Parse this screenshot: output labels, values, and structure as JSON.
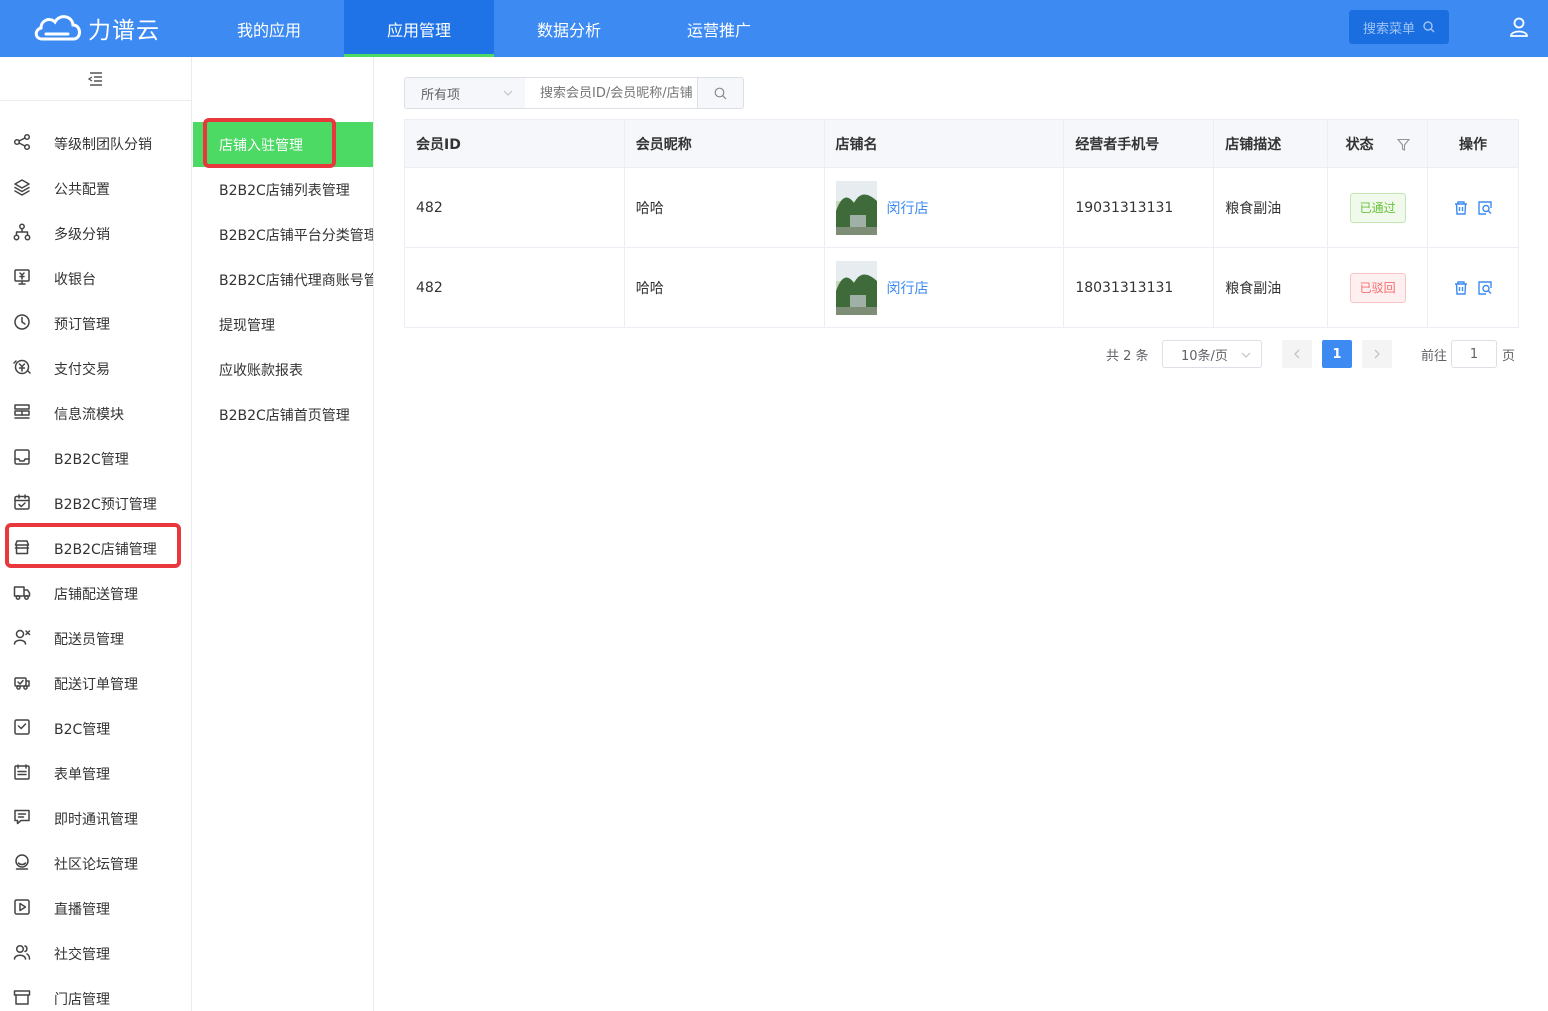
{
  "brand": {
    "name": "力谱云"
  },
  "topnav": {
    "items": [
      {
        "label": "我的应用"
      },
      {
        "label": "应用管理"
      },
      {
        "label": "数据分析"
      },
      {
        "label": "运营推广"
      }
    ],
    "search_menu_label": "搜索菜单"
  },
  "sidebar": {
    "items": [
      {
        "label": "等级制团队分销",
        "icon": "share-icon"
      },
      {
        "label": "公共配置",
        "icon": "layers-icon"
      },
      {
        "label": "多级分销",
        "icon": "org-tree-icon"
      },
      {
        "label": "收银台",
        "icon": "cashier-icon"
      },
      {
        "label": "预订管理",
        "icon": "clock-icon"
      },
      {
        "label": "支付交易",
        "icon": "payment-icon"
      },
      {
        "label": "信息流模块",
        "icon": "feed-icon"
      },
      {
        "label": "B2B2C管理",
        "icon": "inbox-icon"
      },
      {
        "label": "B2B2C预订管理",
        "icon": "calendar-check-icon"
      },
      {
        "label": "B2B2C店铺管理",
        "icon": "store-icon"
      },
      {
        "label": "店铺配送管理",
        "icon": "truck-icon"
      },
      {
        "label": "配送员管理",
        "icon": "courier-icon"
      },
      {
        "label": "配送订单管理",
        "icon": "delivery-order-icon"
      },
      {
        "label": "B2C管理",
        "icon": "inbox-check-icon"
      },
      {
        "label": "表单管理",
        "icon": "form-icon"
      },
      {
        "label": "即时通讯管理",
        "icon": "chat-icon"
      },
      {
        "label": "社区论坛管理",
        "icon": "forum-icon"
      },
      {
        "label": "直播管理",
        "icon": "play-icon"
      },
      {
        "label": "社交管理",
        "icon": "users-icon"
      },
      {
        "label": "门店管理",
        "icon": "shop-icon"
      }
    ]
  },
  "submenu": {
    "items": [
      {
        "label": "店铺入驻管理"
      },
      {
        "label": "B2B2C店铺列表管理"
      },
      {
        "label": "B2B2C店铺平台分类管理"
      },
      {
        "label": "B2B2C店铺代理商账号管"
      },
      {
        "label": "提现管理"
      },
      {
        "label": "应收账款报表"
      },
      {
        "label": "B2B2C店铺首页管理"
      }
    ]
  },
  "filter": {
    "select_value": "所有项",
    "search_placeholder": "搜索会员ID/会员昵称/店铺"
  },
  "table": {
    "columns": [
      "会员ID",
      "会员昵称",
      "店铺名",
      "经营者手机号",
      "店铺描述",
      "状态",
      "操作"
    ],
    "rows": [
      {
        "member_id": "482",
        "nickname": "哈哈",
        "shop_name": "闵行店",
        "phone": "19031313131",
        "description": "粮食副油",
        "status": "已通过",
        "status_color": "#67c23a"
      },
      {
        "member_id": "482",
        "nickname": "哈哈",
        "shop_name": "闵行店",
        "phone": "18031313131",
        "description": "粮食副油",
        "status": "已驳回",
        "status_color": "#f56c6c"
      }
    ]
  },
  "pagination": {
    "total_label": "共 2 条",
    "page_size": "10条/页",
    "current_page": "1",
    "goto_label": "前往",
    "goto_value": "1",
    "page_suffix": "页"
  },
  "colors": {
    "primary": "#3d8bf2",
    "accent_green": "#4cd964",
    "highlight_red": "#e8383d"
  }
}
